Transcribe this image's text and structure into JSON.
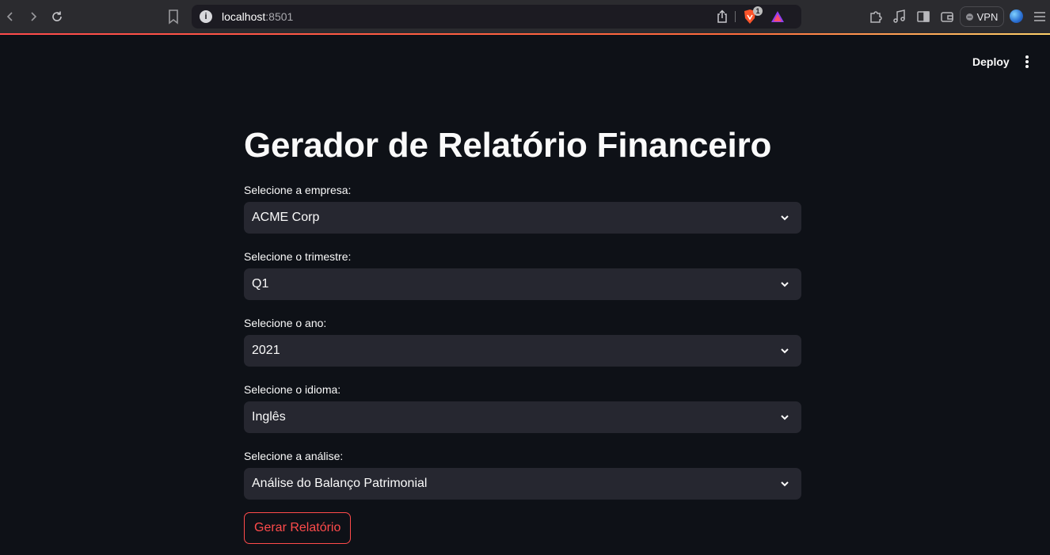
{
  "browser": {
    "url_host": "localhost",
    "url_port": ":8501",
    "shields_badge": "1",
    "vpn_label": "VPN"
  },
  "header": {
    "deploy_label": "Deploy"
  },
  "main": {
    "title": "Gerador de Relatório Financeiro",
    "fields": [
      {
        "label": "Selecione a empresa:",
        "value": "ACME Corp"
      },
      {
        "label": "Selecione o trimestre:",
        "value": "Q1"
      },
      {
        "label": "Selecione o ano:",
        "value": "2021"
      },
      {
        "label": "Selecione o idioma:",
        "value": "Inglês"
      },
      {
        "label": "Selecione a análise:",
        "value": "Análise do Balanço Patrimonial"
      }
    ],
    "submit_label": "Gerar Relatório"
  },
  "colors": {
    "background": "#0e1117",
    "select_background": "#262730",
    "accent": "#ff4b4b",
    "text": "#fafafa"
  }
}
